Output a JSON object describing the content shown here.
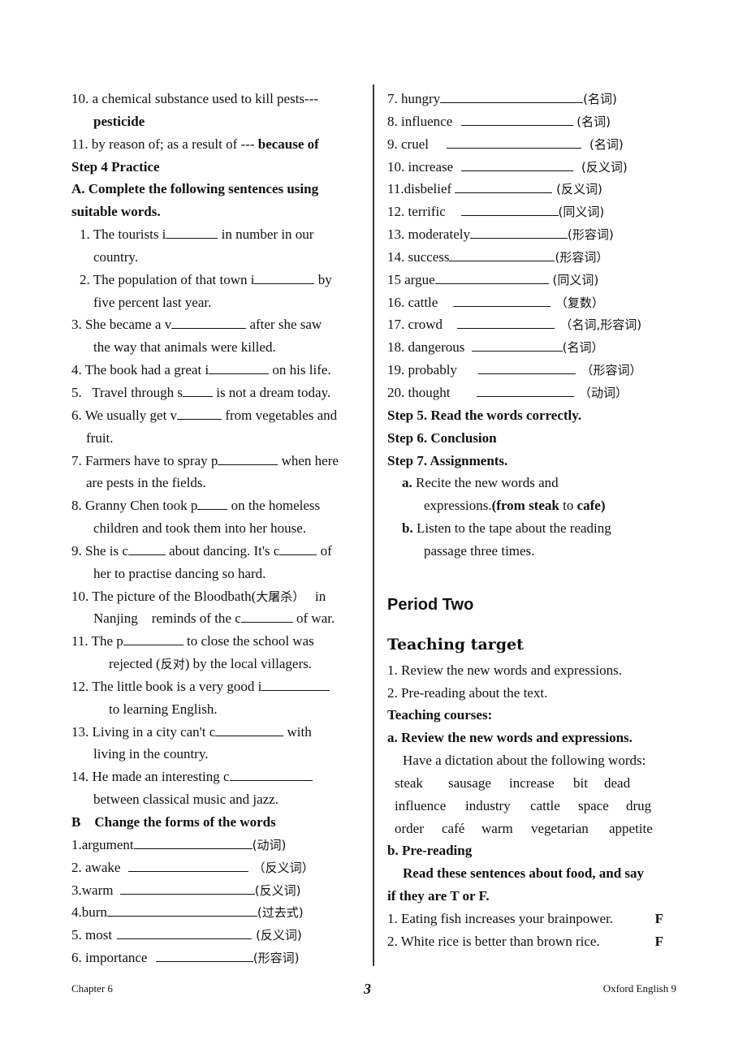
{
  "left_column": {
    "vocab_10_text": "10. a chemical substance used to kill pests---",
    "vocab_10_answer": "pesticide",
    "vocab_11_text": "11. by reason of; as a result of --- ",
    "vocab_11_answer": "because of",
    "step4_title": "Step 4 Practice",
    "sectionA_title_line1": "A. Complete the following sentences using",
    "sectionA_title_line2": "suitable words.",
    "sentences": [
      {
        "l1a": "1. The tourists i",
        "l1b": " in number in our",
        "l2": "country."
      },
      {
        "l1a": "2. The population of that town i",
        "l1b": " by",
        "l2": "five percent last year."
      },
      {
        "l1a": "3. She became a v",
        "l1b": " after she saw",
        "l2": "the way that animals were killed."
      },
      {
        "l1a": "4. The book had a great i",
        "l1b": " on his life."
      },
      {
        "l1a": "5.   Travel through s",
        "l1b": " is not a dream today."
      },
      {
        "l1a": "6. We usually get v",
        "l1b": " from vegetables and",
        "l2": "fruit."
      },
      {
        "l1a": "7. Farmers have to spray p",
        "l1b": " when here",
        "l2": "are pests in the fields."
      },
      {
        "l1a": "8. Granny Chen took p",
        "l1b": " on the homeless",
        "l2": "children and took them into her house."
      },
      {
        "l1a": "9. She is c",
        "l1b": " about dancing. It's c",
        "l1c": " of",
        "l2": "her to practise dancing so hard."
      },
      {
        "l1a": "10. The picture of the Bloodbath(",
        "l1cn": "大屠杀）",
        "l1b": "   in",
        "l2a": "Nanjing    reminds of the c",
        "l2b": " of war."
      },
      {
        "l1a": "11. The p",
        "l1b": " to close the school was",
        "l2a": "rejected (",
        "l2cn": "反对",
        "l2b": ") by the local villagers."
      },
      {
        "l1a": "12. The little book is a very good i",
        "l2": "to learning English."
      },
      {
        "l1a": "13. Living in a city can't c",
        "l1b": " with",
        "l2": "living in the country."
      },
      {
        "l1a": "14. He made an interesting c",
        "l2": "between classical music and jazz."
      }
    ],
    "sectionB_title": "B    Change the forms of the words",
    "forms": [
      {
        "word": "1.argument",
        "pos": "(动词)"
      },
      {
        "word": "2. awake ",
        "pos": "（反义词）"
      },
      {
        "word": "3.warm ",
        "pos": "(反义词)"
      },
      {
        "word": "4.burn",
        "pos": "(过去式)"
      },
      {
        "word": "5. most ",
        "pos": " (反义词)"
      },
      {
        "word": "6. importance ",
        "pos": "(形容词)"
      }
    ]
  },
  "right_column": {
    "forms": [
      {
        "word": "7. hungry",
        "pos": "(名词)"
      },
      {
        "word": "8. influence ",
        "pos": " (名词)"
      },
      {
        "word": "9. cruel  ",
        "pos": "  (名词)"
      },
      {
        "word": "10. increase ",
        "pos": "  (反义词)"
      },
      {
        "word": "11.disbelief ",
        "pos": " (反义词)"
      },
      {
        "word": "12. terrific   ",
        "pos": "(同义词)"
      },
      {
        "word": "13. moderately",
        "pos": "(形容词)"
      },
      {
        "word": "14. success",
        "pos": "(形容词）"
      },
      {
        "word": "15 argue",
        "pos": " (同义词)"
      },
      {
        "word": "16. cattle  ",
        "pos": "（复数）"
      },
      {
        "word": "17. crowd  ",
        "pos": "（名词,形容词)"
      },
      {
        "word": "18. dangerous ",
        "pos": "(名词）"
      },
      {
        "word": "19. probably  ",
        "pos": "（形容词）"
      },
      {
        "word": "20. thought  ",
        "pos": "（动词）"
      }
    ],
    "step5": "Step 5. Read the words correctly.",
    "step6": "Step 6. Conclusion",
    "step7": "Step 7. Assignments.",
    "assign_a_label": "a.",
    "assign_a_l1": " Recite the new words and",
    "assign_a_l2_pre": "expressions.",
    "assign_a_l2_paren": "(from ",
    "assign_a_l2_steak": "steak",
    "assign_a_l2_to": " to ",
    "assign_a_l2_cafe": "cafe)",
    "assign_b_label": "b.",
    "assign_b_l1": " Listen to the tape about the reading",
    "assign_b_l2": "passage three times.",
    "period_title": "Period Two",
    "teaching_target_title": "Teaching target",
    "targets": [
      "1. Review the new words and expressions.",
      "2. Pre-reading about the text."
    ],
    "teaching_courses": "Teaching courses:",
    "course_a_title": "a. Review the new words and expressions.",
    "course_a_intro": "Have a dictation about the following words:",
    "dictation_rows": [
      [
        "steak",
        "sausage",
        "increase",
        "bit",
        "dead"
      ],
      [
        "influence",
        "industry",
        "cattle",
        "space",
        "drug"
      ],
      [
        "order",
        "café",
        "warm",
        "vegetarian",
        "appetite"
      ]
    ],
    "course_b_title": "b. Pre-reading",
    "course_b_instr_l1": "Read these sentences about food, and say",
    "course_b_instr_l2": "if they are T or F.",
    "tf_items": [
      {
        "text": "1. Eating fish increases your brainpower.",
        "answer": "F"
      },
      {
        "text": "2. White rice is better than brown rice.",
        "answer": "F"
      }
    ]
  },
  "footer": {
    "left": "Chapter 6",
    "page_number": "3",
    "right": "Oxford English 9"
  }
}
